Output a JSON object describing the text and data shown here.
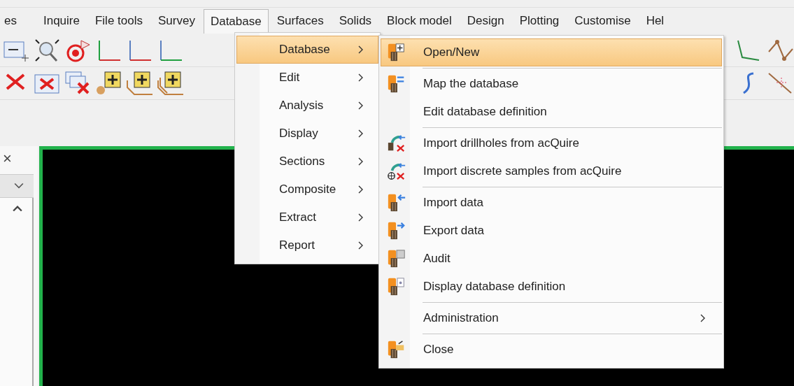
{
  "menu_bar": [
    {
      "label": "es",
      "selected": false
    },
    {
      "label": "Inquire",
      "selected": false
    },
    {
      "label": "File tools",
      "selected": false
    },
    {
      "label": "Survey",
      "selected": false
    },
    {
      "label": "Database",
      "selected": true
    },
    {
      "label": "Surfaces",
      "selected": false
    },
    {
      "label": "Solids",
      "selected": false
    },
    {
      "label": "Block model",
      "selected": false
    },
    {
      "label": "Design",
      "selected": false
    },
    {
      "label": "Plotting",
      "selected": false
    },
    {
      "label": "Customise",
      "selected": false
    },
    {
      "label": "Hel",
      "selected": false
    }
  ],
  "side_panel": {
    "close": "×"
  },
  "database_menu": [
    {
      "label": "Database",
      "selected": true
    },
    {
      "label": "Edit",
      "selected": false
    },
    {
      "label": "Analysis",
      "selected": false
    },
    {
      "label": "Display",
      "selected": false
    },
    {
      "label": "Sections",
      "selected": false
    },
    {
      "label": "Composite",
      "selected": false
    },
    {
      "label": "Extract",
      "selected": false
    },
    {
      "label": "Report",
      "selected": false
    }
  ],
  "database_submenu": [
    [
      {
        "label": "Open/New",
        "kind": "database",
        "selected": true
      }
    ],
    [
      {
        "label": "Map the database",
        "kind": "database",
        "selected": false
      },
      {
        "label": "Edit database definition",
        "kind": "plain",
        "selected": false
      }
    ],
    [
      {
        "label": "Import drillholes from acQuire",
        "kind": "acquire",
        "selected": false
      },
      {
        "label": "Import discrete samples from acQuire",
        "kind": "acquire",
        "selected": false
      }
    ],
    [
      {
        "label": "Import data",
        "kind": "database",
        "selected": false
      },
      {
        "label": "Export data",
        "kind": "database",
        "selected": false
      },
      {
        "label": "Audit",
        "kind": "database",
        "selected": false
      },
      {
        "label": "Display database definition",
        "kind": "database",
        "selected": false
      }
    ],
    [
      {
        "label": "Administration",
        "kind": "submenu",
        "selected": false
      }
    ],
    [
      {
        "label": "Close",
        "kind": "database",
        "selected": false
      }
    ]
  ]
}
